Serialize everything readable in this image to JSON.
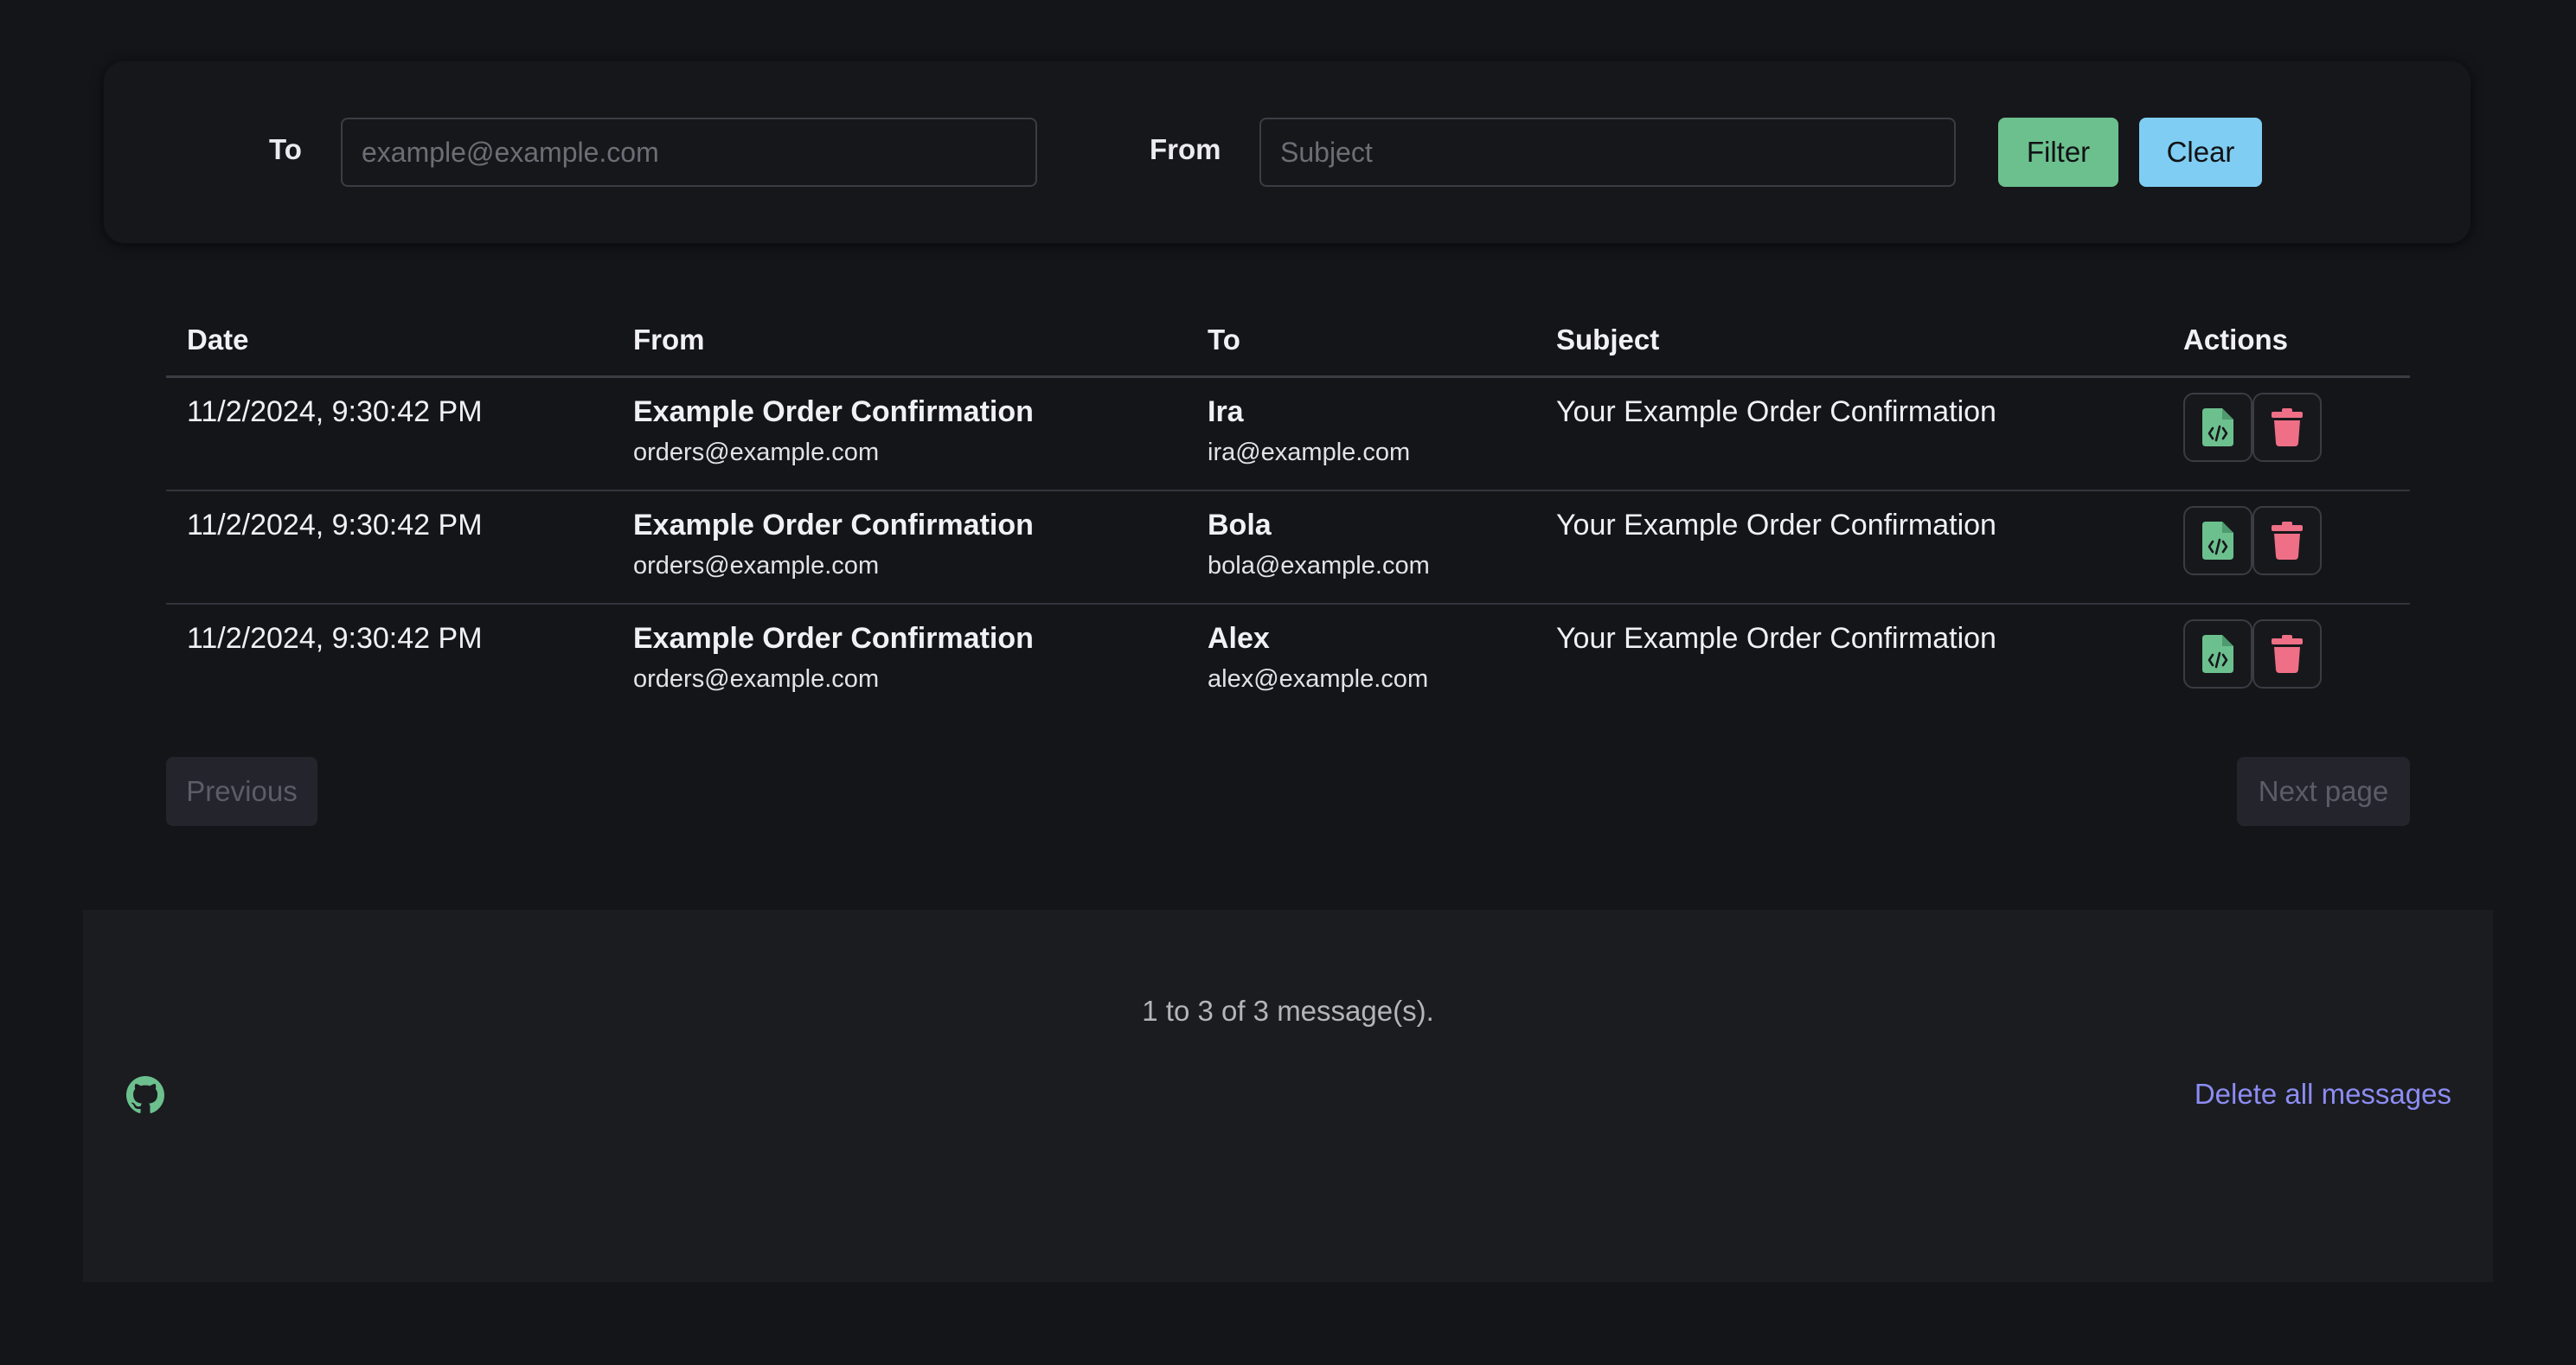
{
  "filter": {
    "to_label": "To",
    "to_placeholder": "example@example.com",
    "to_value": "",
    "from_label": "From",
    "from_placeholder": "Subject",
    "from_value": "",
    "filter_button": "Filter",
    "clear_button": "Clear"
  },
  "table": {
    "headers": {
      "date": "Date",
      "from": "From",
      "to": "To",
      "subject": "Subject",
      "actions": "Actions"
    },
    "rows": [
      {
        "date": "11/2/2024, 9:30:42 PM",
        "from_name": "Example Order Confirmation",
        "from_email": "orders@example.com",
        "to_name": "Ira",
        "to_email": "ira@example.com",
        "subject": "Your Example Order Confirmation"
      },
      {
        "date": "11/2/2024, 9:30:42 PM",
        "from_name": "Example Order Confirmation",
        "from_email": "orders@example.com",
        "to_name": "Bola",
        "to_email": "bola@example.com",
        "subject": "Your Example Order Confirmation"
      },
      {
        "date": "11/2/2024, 9:30:42 PM",
        "from_name": "Example Order Confirmation",
        "from_email": "orders@example.com",
        "to_name": "Alex",
        "to_email": "alex@example.com",
        "subject": "Your Example Order Confirmation"
      }
    ],
    "row_actions": [
      "view-html-icon",
      "trash-icon"
    ]
  },
  "pagination": {
    "previous": "Previous",
    "next": "Next page"
  },
  "footer": {
    "count_text": "1 to 3 of 3 message(s).",
    "delete_all": "Delete all messages",
    "github_icon": "github-icon"
  },
  "colors": {
    "background": "#141519",
    "filter_button": "#6cc08e",
    "clear_button": "#7fcdf3",
    "view_icon": "#6cc08e",
    "trash_icon": "#ef6f86",
    "link": "#8c8cf2"
  }
}
